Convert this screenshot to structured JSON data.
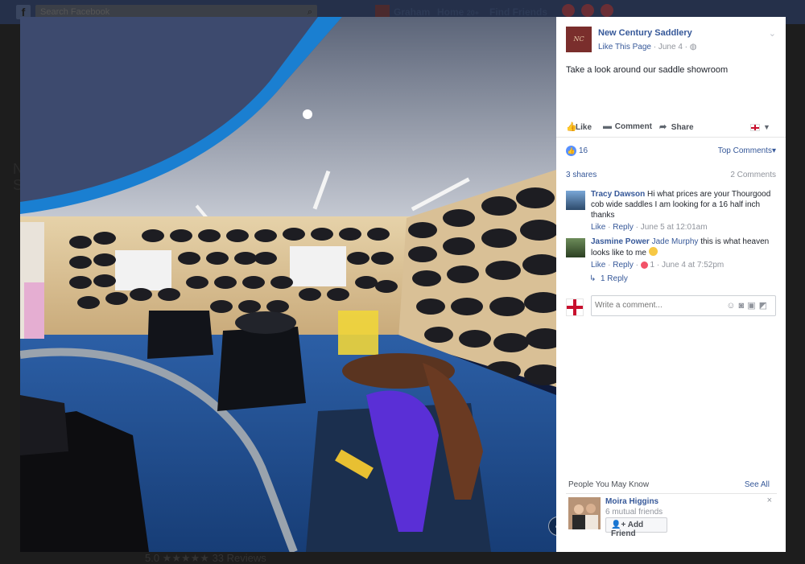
{
  "topbar": {
    "search_placeholder": "Search Facebook",
    "user_name": "Graham",
    "home_label": "Home",
    "home_count": "20+",
    "find_friends_label": "Find Friends"
  },
  "background_page": {
    "left_text_line1": "N",
    "left_text_line2": "S",
    "rating": "5.0 ★★★★★ 33 Reviews"
  },
  "photo": {
    "alt": "saddle showroom photo",
    "view_360_icon": "360-photo-icon"
  },
  "post": {
    "page_name": "New Century Saddlery",
    "like_page_label": "Like This Page",
    "date": "June 4",
    "privacy_icon": "globe-icon",
    "text": "Take a look around our saddle showroom",
    "actions": {
      "like": "Like",
      "comment": "Comment",
      "share": "Share"
    },
    "reaction_count": "16",
    "sort_label": "Top Comments",
    "shares": "3 shares",
    "comments_count": "2 Comments"
  },
  "comments": [
    {
      "author": "Tracy Dawson",
      "text": "Hi what prices are your Thourgood cob wide saddles I am looking for a 16 half inch thanks",
      "like": "Like",
      "reply": "Reply",
      "time": "June 5 at 12:01am"
    },
    {
      "author": "Jasmine Power",
      "mention": "Jade Murphy",
      "text": "this is what heaven looks like to me",
      "like": "Like",
      "reply": "Reply",
      "reactions": "1",
      "time": "June 4 at 7:52pm"
    }
  ],
  "reply_link": "1 Reply",
  "write_comment": {
    "placeholder": "Write a comment..."
  },
  "people_you_may_know": {
    "heading": "People You May Know",
    "see_all": "See All",
    "person_name": "Moira Higgins",
    "mutual": "6 mutual friends",
    "add_friend": "Add Friend"
  },
  "colors": {
    "link": "#365899",
    "panel_bg": "#ffffff",
    "overlay_bg": "#1d1d1d",
    "showroom_carpet": "#1f4f8f"
  }
}
